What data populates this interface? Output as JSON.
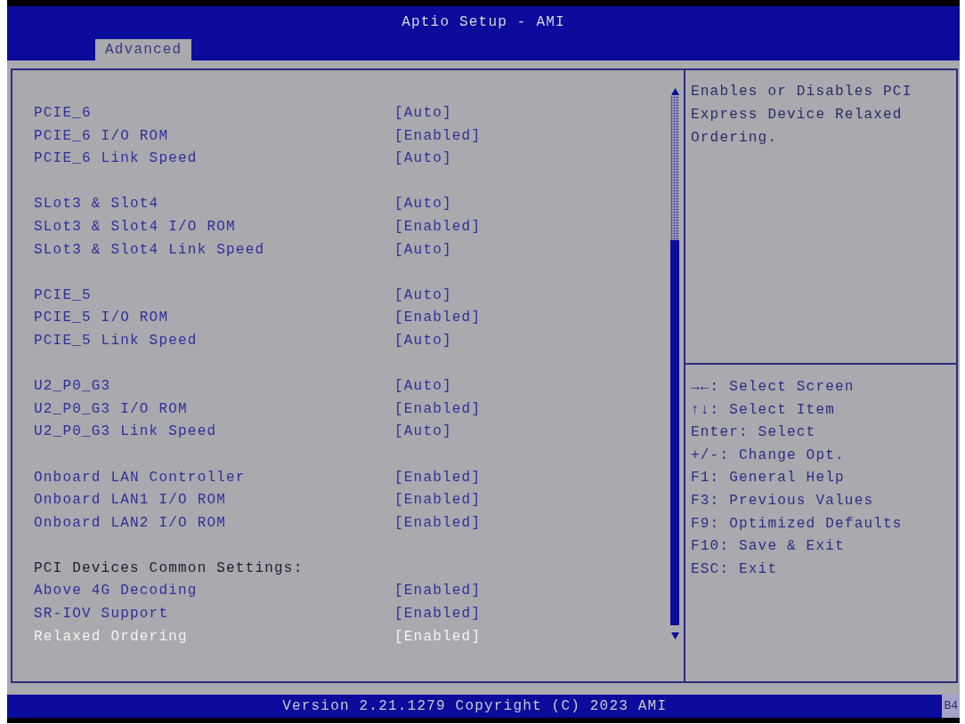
{
  "window": {
    "title": "Aptio Setup - AMI"
  },
  "tabs": [
    {
      "label": "Advanced",
      "selected": true
    }
  ],
  "settings": {
    "groups": [
      {
        "items": [
          {
            "label": "PCIE_6",
            "value": "[Auto]",
            "selected": false
          },
          {
            "label": "PCIE_6 I/O ROM",
            "value": "[Enabled]",
            "selected": false
          },
          {
            "label": "PCIE_6 Link Speed",
            "value": "[Auto]",
            "selected": false
          }
        ]
      },
      {
        "items": [
          {
            "label": "SLot3 & Slot4",
            "value": "[Auto]",
            "selected": false
          },
          {
            "label": "SLot3 & Slot4 I/O ROM",
            "value": "[Enabled]",
            "selected": false
          },
          {
            "label": "SLot3 & Slot4 Link Speed",
            "value": "[Auto]",
            "selected": false
          }
        ]
      },
      {
        "items": [
          {
            "label": "PCIE_5",
            "value": "[Auto]",
            "selected": false
          },
          {
            "label": "PCIE_5 I/O ROM",
            "value": "[Enabled]",
            "selected": false
          },
          {
            "label": "PCIE_5 Link Speed",
            "value": "[Auto]",
            "selected": false
          }
        ]
      },
      {
        "items": [
          {
            "label": "U2_P0_G3",
            "value": "[Auto]",
            "selected": false
          },
          {
            "label": "U2_P0_G3 I/O ROM",
            "value": "[Enabled]",
            "selected": false
          },
          {
            "label": "U2_P0_G3 Link Speed",
            "value": "[Auto]",
            "selected": false
          }
        ]
      },
      {
        "items": [
          {
            "label": "Onboard LAN Controller",
            "value": "[Enabled]",
            "selected": false
          },
          {
            "label": "Onboard LAN1 I/O ROM",
            "value": "[Enabled]",
            "selected": false
          },
          {
            "label": "Onboard LAN2 I/O ROM",
            "value": "[Enabled]",
            "selected": false
          }
        ]
      },
      {
        "heading": "PCI Devices Common Settings:",
        "items": [
          {
            "label": "Above 4G Decoding",
            "value": "[Enabled]",
            "selected": false
          },
          {
            "label": "SR-IOV Support",
            "value": "[Enabled]",
            "selected": false
          },
          {
            "label": "Relaxed Ordering",
            "value": "[Enabled]",
            "selected": true
          }
        ]
      }
    ]
  },
  "help": {
    "text": "Enables or Disables PCI Express Device Relaxed Ordering."
  },
  "key_legend": [
    "→←: Select Screen",
    "↑↓: Select Item",
    "Enter: Select",
    "+/-: Change Opt.",
    "F1: General Help",
    "F3: Previous Values",
    "F9: Optimized Defaults",
    "F10: Save & Exit",
    "ESC: Exit"
  ],
  "status_bar": {
    "text": "Version 2.21.1279 Copyright (C) 2023 AMI",
    "code": "B4"
  }
}
